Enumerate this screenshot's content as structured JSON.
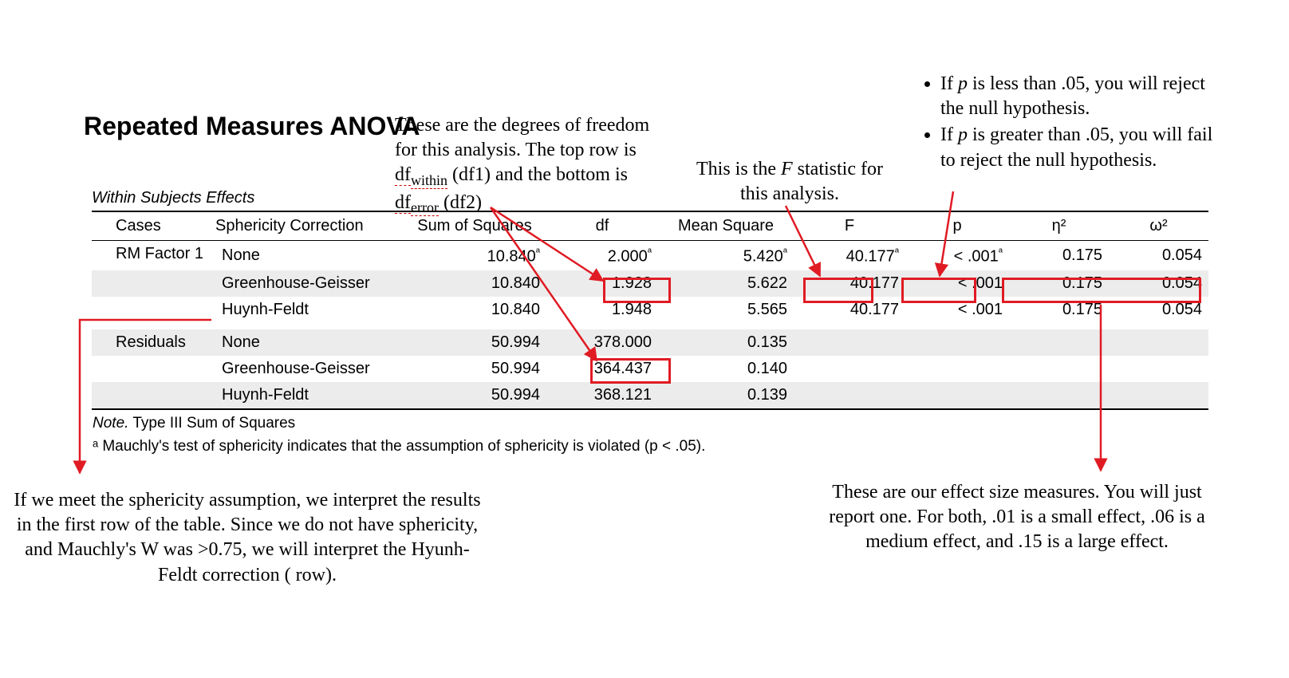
{
  "title": "Repeated Measures ANOVA",
  "subtitle": "Within Subjects Effects",
  "headers": {
    "cases": "Cases",
    "correction": "Sphericity Correction",
    "ss": "Sum of Squares",
    "df": "df",
    "ms": "Mean Square",
    "F": "F",
    "p": "p",
    "eta2": "η²",
    "omega2": "ω²"
  },
  "rows": {
    "rm1_none": {
      "cases": "RM Factor 1",
      "corr": "None",
      "ss": "10.840",
      "ssSup": "ᵃ",
      "df": "2.000",
      "dfSup": "ᵃ",
      "ms": "5.420",
      "msSup": "ᵃ",
      "F": "40.177",
      "FSup": "ᵃ",
      "p": "< .001",
      "pSup": "ᵃ",
      "eta": "0.175",
      "omega": "0.054"
    },
    "rm1_gg": {
      "cases": "",
      "corr": "Greenhouse-Geisser",
      "ss": "10.840",
      "df": "1.928",
      "ms": "5.622",
      "F": "40.177",
      "p": "< .001",
      "eta": "0.175",
      "omega": "0.054"
    },
    "rm1_hf": {
      "cases": "",
      "corr": "Huynh-Feldt",
      "ss": "10.840",
      "df": "1.948",
      "ms": "5.565",
      "F": "40.177",
      "p": "< .001",
      "eta": "0.175",
      "omega": "0.054"
    },
    "res_none": {
      "cases": "Residuals",
      "corr": "None",
      "ss": "50.994",
      "df": "378.000",
      "ms": "0.135"
    },
    "res_gg": {
      "cases": "",
      "corr": "Greenhouse-Geisser",
      "ss": "50.994",
      "df": "364.437",
      "ms": "0.140"
    },
    "res_hf": {
      "cases": "",
      "corr": "Huynh-Feldt",
      "ss": "50.994",
      "df": "368.121",
      "ms": "0.139"
    }
  },
  "note": "Type III Sum of Squares",
  "noteLabel": "Note.",
  "footnote": "ᵃ Mauchly's test of sphericity indicates that the assumption of sphericity is violated (p < .05).",
  "annotations": {
    "df_expl_a": "These are the degrees of freedom",
    "df_expl_b": "for this analysis. The top row is",
    "df_expl_c1": "df",
    "df_expl_c2": "within",
    "df_expl_c3": " (df1) and the bottom is",
    "df_expl_d1": "df",
    "df_expl_d2": "error",
    "df_expl_d3": " (df2)",
    "f_expl_a": "This is the ",
    "f_expl_b": "F",
    "f_expl_c": " statistic for",
    "f_expl_d": "this analysis.",
    "p_bullet1a": "If ",
    "p_bullet1b": "p",
    "p_bullet1c": " is less than .05, you will reject the null hypothesis.",
    "p_bullet2a": "If ",
    "p_bullet2b": "p",
    "p_bullet2c": " is greater than .05, you will fail to reject the null hypothesis.",
    "sphericity": "If we meet the sphericity assumption, we interpret the results in the first row of the table. Since we do not have sphericity, and Mauchly's W was >0.75, we will interpret the Hyunh-Feldt correction ( row).",
    "effect": "These are our effect size measures. You will just report one. For both, .01 is a small effect, .06 is a medium effect, and .15 is a large effect."
  },
  "chart_data": {
    "type": "table",
    "title": "Repeated Measures ANOVA — Within Subjects Effects",
    "columns": [
      "Cases",
      "Sphericity Correction",
      "Sum of Squares",
      "df",
      "Mean Square",
      "F",
      "p",
      "η²",
      "ω²"
    ],
    "rows": [
      [
        "RM Factor 1",
        "None",
        10.84,
        2.0,
        5.42,
        40.177,
        "< .001",
        0.175,
        0.054
      ],
      [
        "RM Factor 1",
        "Greenhouse-Geisser",
        10.84,
        1.928,
        5.622,
        40.177,
        "< .001",
        0.175,
        0.054
      ],
      [
        "RM Factor 1",
        "Huynh-Feldt",
        10.84,
        1.948,
        5.565,
        40.177,
        "< .001",
        0.175,
        0.054
      ],
      [
        "Residuals",
        "None",
        50.994,
        378.0,
        0.135,
        null,
        null,
        null,
        null
      ],
      [
        "Residuals",
        "Greenhouse-Geisser",
        50.994,
        364.437,
        0.14,
        null,
        null,
        null,
        null
      ],
      [
        "Residuals",
        "Huynh-Feldt",
        50.994,
        368.121,
        0.139,
        null,
        null,
        null,
        null
      ]
    ],
    "note": "Type III Sum of Squares. Superscript a: Mauchly's test of sphericity indicates that the assumption of sphericity is violated (p < .05)."
  }
}
